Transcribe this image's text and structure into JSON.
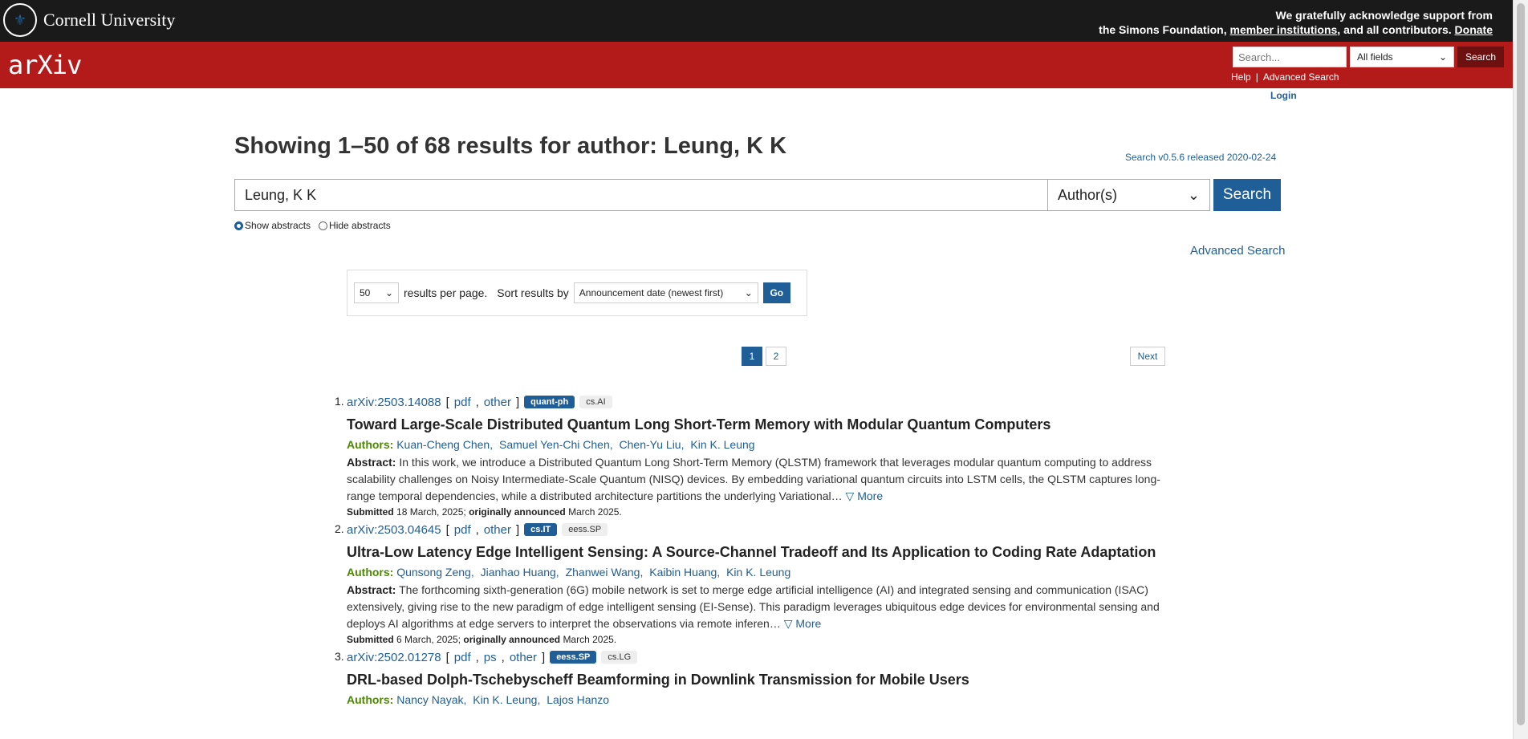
{
  "header": {
    "cornell_name": "Cornell University",
    "ack_line1": "We gratefully acknowledge support from",
    "ack_line2_pre": "the Simons Foundation,",
    "member_link": "member institutions",
    "ack_line2_post": ", and all contributors.",
    "donate_link": "Donate",
    "arxiv_logo": "arXiv",
    "search_placeholder": "Search...",
    "field_select": "All fields",
    "search_button": "Search",
    "help_link": "Help",
    "separator": "|",
    "advanced_link": "Advanced Search",
    "login_link": "Login"
  },
  "main": {
    "title": "Showing 1–50 of 68 results for author: Leung, K K",
    "release_link": "Search v0.5.6 released 2020-02-24",
    "query_value": "Leung, K K",
    "field_value": "Author(s)",
    "search_button": "Search",
    "show_abstracts": "Show abstracts",
    "hide_abstracts": "Hide abstracts",
    "advanced_search": "Advanced Search",
    "per_page_value": "50",
    "per_page_label": "results per page.",
    "sort_label": "Sort results by",
    "sort_value": "Announcement date (newest first)",
    "go_button": "Go",
    "pages": [
      "1",
      "2"
    ],
    "next": "Next"
  },
  "results": [
    {
      "num": "1.",
      "id": "arXiv:2503.14088",
      "links": [
        "pdf",
        "other"
      ],
      "primary_tag": "quant-ph",
      "secondary_tag": "cs.AI",
      "title": "Toward Large-Scale Distributed Quantum Long Short-Term Memory with Modular Quantum Computers",
      "authors_label": "Authors:",
      "authors": [
        "Kuan-Cheng Chen,",
        "Samuel Yen-Chi Chen,",
        "Chen-Yu Liu,",
        "Kin K. Leung"
      ],
      "abstract_label": "Abstract:",
      "abstract": "In this work, we introduce a Distributed Quantum Long Short-Term Memory (QLSTM) framework that leverages modular quantum computing to address scalability challenges on Noisy Intermediate-Scale Quantum (NISQ) devices. By embedding variational quantum circuits into LSTM cells, the QLSTM captures long-range temporal dependencies, while a distributed architecture partitions the underlying Variational…",
      "more": "▽ More",
      "submitted_label": "Submitted",
      "submitted_date": "18 March, 2025;",
      "announced_label": "originally announced",
      "announced_date": "March 2025."
    },
    {
      "num": "2.",
      "id": "arXiv:2503.04645",
      "links": [
        "pdf",
        "other"
      ],
      "primary_tag": "cs.IT",
      "secondary_tag": "eess.SP",
      "title": "Ultra-Low Latency Edge Intelligent Sensing: A Source-Channel Tradeoff and Its Application to Coding Rate Adaptation",
      "authors_label": "Authors:",
      "authors": [
        "Qunsong Zeng,",
        "Jianhao Huang,",
        "Zhanwei Wang,",
        "Kaibin Huang,",
        "Kin K. Leung"
      ],
      "abstract_label": "Abstract:",
      "abstract": "The forthcoming sixth-generation (6G) mobile network is set to merge edge artificial intelligence (AI) and integrated sensing and communication (ISAC) extensively, giving rise to the new paradigm of edge intelligent sensing (EI-Sense). This paradigm leverages ubiquitous edge devices for environmental sensing and deploys AI algorithms at edge servers to interpret the observations via remote inferen…",
      "more": "▽ More",
      "submitted_label": "Submitted",
      "submitted_date": "6 March, 2025;",
      "announced_label": "originally announced",
      "announced_date": "March 2025."
    },
    {
      "num": "3.",
      "id": "arXiv:2502.01278",
      "links": [
        "pdf",
        "ps",
        "other"
      ],
      "primary_tag": "eess.SP",
      "secondary_tag": "cs.LG",
      "title": "DRL-based Dolph-Tschebyscheff Beamforming in Downlink Transmission for Mobile Users",
      "authors_label": "Authors:",
      "authors": [
        "Nancy Nayak,",
        "Kin K. Leung,",
        "Lajos Hanzo"
      ]
    }
  ]
}
